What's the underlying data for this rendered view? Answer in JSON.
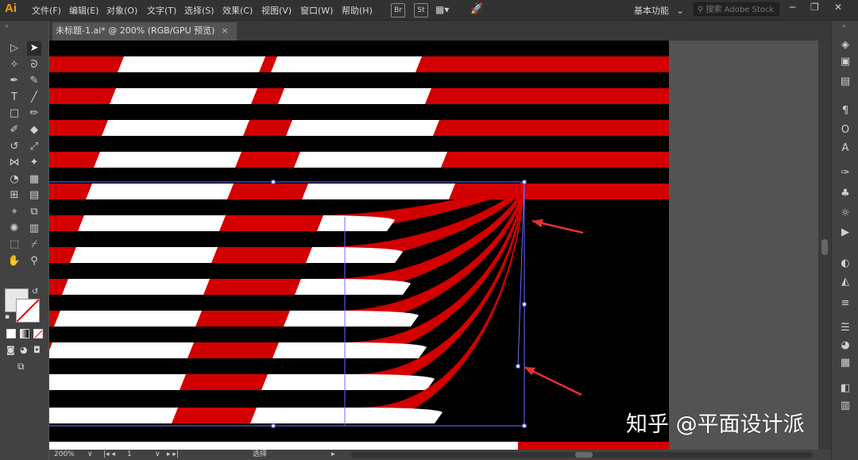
{
  "app": {
    "logo": "Ai"
  },
  "menu": [
    "文件(F)",
    "编辑(E)",
    "对象(O)",
    "文字(T)",
    "选择(S)",
    "效果(C)",
    "视图(V)",
    "窗口(W)",
    "帮助(H)"
  ],
  "menubar_icons": [
    "bridge-icon",
    "stock-icon",
    "arrange-documents-icon",
    "gpu-performance-icon"
  ],
  "workspace": {
    "label": "基本功能",
    "chevron": "⌄"
  },
  "search": {
    "placeholder": "搜索 Adobe Stock"
  },
  "window_controls": [
    "─",
    "❐",
    "✕"
  ],
  "document_tab": {
    "title": "未标题-1.ai* @ 200% (RGB/GPU 预览)",
    "close": "×"
  },
  "tools": [
    {
      "name": "selection-tool-icon",
      "glyph": "▷"
    },
    {
      "name": "direct-selection-tool-icon",
      "glyph": "➤",
      "active": true
    },
    {
      "name": "magic-wand-tool-icon",
      "glyph": "✧"
    },
    {
      "name": "lasso-tool-icon",
      "glyph": "ᘐ"
    },
    {
      "name": "pen-tool-icon",
      "glyph": "✒"
    },
    {
      "name": "curvature-tool-icon",
      "glyph": "✎"
    },
    {
      "name": "type-tool-icon",
      "glyph": "T"
    },
    {
      "name": "line-tool-icon",
      "glyph": "╱"
    },
    {
      "name": "rectangle-tool-icon",
      "glyph": "□"
    },
    {
      "name": "paintbrush-tool-icon",
      "glyph": "✏"
    },
    {
      "name": "shaper-tool-icon",
      "glyph": "✐"
    },
    {
      "name": "eraser-tool-icon",
      "glyph": "◆"
    },
    {
      "name": "rotate-tool-icon",
      "glyph": "↺"
    },
    {
      "name": "scale-tool-icon",
      "glyph": "⤢"
    },
    {
      "name": "width-tool-icon",
      "glyph": "⋈"
    },
    {
      "name": "puppet-warp-tool-icon",
      "glyph": "✦"
    },
    {
      "name": "shape-builder-tool-icon",
      "glyph": "◔"
    },
    {
      "name": "live-paint-tool-icon",
      "glyph": "▦"
    },
    {
      "name": "mesh-tool-icon",
      "glyph": "⊞"
    },
    {
      "name": "gradient-tool-icon",
      "glyph": "▤"
    },
    {
      "name": "eyedropper-tool-icon",
      "glyph": "⌖"
    },
    {
      "name": "blend-tool-icon",
      "glyph": "⧉"
    },
    {
      "name": "symbol-sprayer-tool-icon",
      "glyph": "✺"
    },
    {
      "name": "column-graph-tool-icon",
      "glyph": "▥"
    },
    {
      "name": "artboard-tool-icon",
      "glyph": "⬚"
    },
    {
      "name": "slice-tool-icon",
      "glyph": "⌿"
    },
    {
      "name": "hand-tool-icon",
      "glyph": "✋"
    },
    {
      "name": "zoom-tool-icon",
      "glyph": "⚲"
    }
  ],
  "right_panel_icons": [
    "layers-icon",
    "libraries-icon",
    "properties-icon",
    "paragraph-icon",
    "opentype-icon",
    "character-icon",
    "brushes-icon",
    "symbols-icon",
    "appearance-icon",
    "actions-icon",
    "color-icon",
    "color-guide-icon",
    "stroke-icon",
    "align-icon",
    "transparency-icon",
    "transform-icon",
    "pathfinder-icon",
    "artboards-icon"
  ],
  "colors": {
    "stripe_red": "#d20000",
    "stripe_white": "#ffffff",
    "artboard_bg": "#000000",
    "arrow": "#e8312f",
    "path_outline": "#6b6bff"
  },
  "status": {
    "zoom": "200%",
    "zoom_chevron": "∨",
    "artboard_number": "1",
    "artboard_chevron": "∨",
    "mode": "选择"
  },
  "watermark": "知乎 @平面设计派"
}
